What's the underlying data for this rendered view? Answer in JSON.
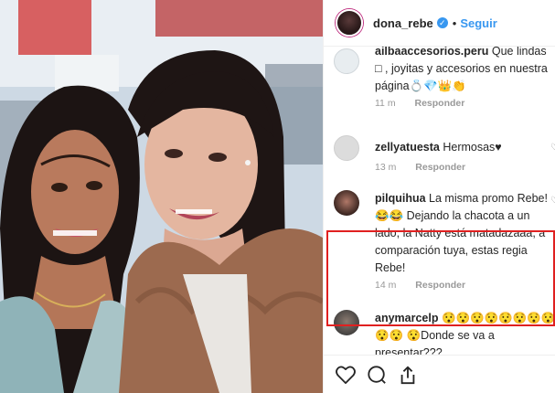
{
  "post": {
    "username": "dona_rebe",
    "verified_icon": "verified-badge-icon",
    "separator": "•",
    "follow_label": "Seguir"
  },
  "comments": [
    {
      "user": "ailbaaccesorios.peru",
      "text": " Que lindas □ , joyitas y accesorios en nuestra página💍💎👑👏",
      "time": "11 m",
      "reply": "Responder"
    },
    {
      "user": "zellyatuesta",
      "text": " Hermosas♥",
      "time": "13 m",
      "reply": "Responder"
    },
    {
      "user": "pilquihua",
      "text": " La misma promo Rebe! 😂😂 Dejando la chacota a un lado, la Natty está matadazaaa, a comparación tuya, estas regia Rebe!",
      "time": "14 m",
      "reply": "Responder"
    },
    {
      "user": "anymarcelp",
      "text": " 😯😯😯😯😯😯😯😯😯😯 😯Donde se va a presentar???",
      "time": "",
      "reply": ""
    }
  ],
  "colors": {
    "link": "#3897f0",
    "highlight": "#e02020",
    "meta": "#999999"
  }
}
